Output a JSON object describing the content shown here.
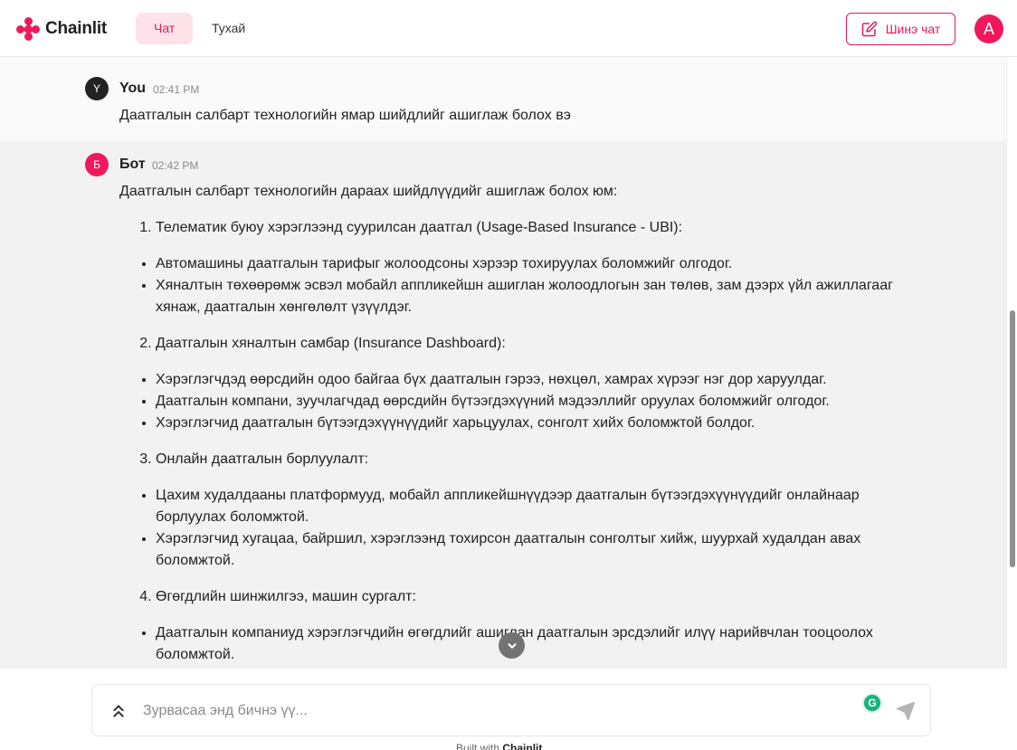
{
  "header": {
    "brand": "Chainlit",
    "tabs": [
      {
        "label": "Чат",
        "active": true
      },
      {
        "label": "Тухай",
        "active": false
      }
    ],
    "new_chat_label": "Шинэ чат",
    "user_initial": "A"
  },
  "colors": {
    "accent": "#e9185c",
    "accent_light": "#fde2ea",
    "bot_message_bg": "#f2f2f2"
  },
  "messages": [
    {
      "role": "user",
      "avatar_letter": "Y",
      "author": "You",
      "time": "02:41 PM",
      "text": "Даатгалын салбарт технологийн ямар шийдлийг ашиглаж болох вэ"
    },
    {
      "role": "bot",
      "avatar_letter": "Б",
      "author": "Бот",
      "time": "02:42 PM",
      "intro": "Даатгалын салбарт технологийн дараах шийдлүүдийг ашиглаж болох юм:",
      "sections": [
        {
          "title": "Телематик буюу хэрэглээнд суурилсан даатгал (Usage-Based Insurance - UBI):",
          "bullets": [
            "Автомашины даатгалын тарифыг жолоодсоны хэрээр тохируулах боломжийг олгодог.",
            "Хяналтын төхөөрөмж эсвэл мобайл аппликейшн ашиглан жолоодлогын зан төлөв, зам дээрх үйл ажиллагааг хянаж, даатгалын хөнгөлөлт үзүүлдэг."
          ]
        },
        {
          "title": "Даатгалын хяналтын самбар (Insurance Dashboard):",
          "bullets": [
            "Хэрэглэгчдэд өөрсдийн одоо байгаа бүх даатгалын гэрээ, нөхцөл, хамрах хүрээг нэг дор харуулдаг.",
            "Даатгалын компани, зуучлагчдад өөрсдийн бүтээгдэхүүний мэдээллийг оруулах боломжийг олгодог.",
            "Хэрэглэгчид даатгалын бүтээгдэхүүнүүдийг харьцуулах, сонголт хийх боломжтой болдог."
          ]
        },
        {
          "title": "Онлайн даатгалын борлуулалт:",
          "bullets": [
            "Цахим худалдааны платформууд, мобайл аппликейшнүүдээр даатгалын бүтээгдэхүүнүүдийг онлайнаар борлуулах боломжтой.",
            "Хэрэглэгчид хугацаа, байршил, хэрэглээнд тохирсон даатгалын сонголтыг хийж, шуурхай худалдан авах боломжтой."
          ]
        },
        {
          "title": "Өгөгдлийн шинжилгээ, машин сургалт:",
          "bullets": [
            "Даатгалын компаниуд хэрэглэгчдийн өгөгдлийг ашиглан даатгалын эрсдэлийг илүү нарийвчлан тооцоолох боломжтой."
          ]
        }
      ]
    }
  ],
  "composer": {
    "placeholder": "Зурвасаа энд бичнэ үү..."
  },
  "footer": {
    "built_with_label": "Built with",
    "brand": "Chainlit"
  },
  "icons": {
    "composer_toggle": "chevrons-up-icon",
    "send": "send-icon",
    "new_chat": "edit-icon",
    "scroll_down": "chevron-down-icon",
    "grammarly": "grammarly-icon"
  }
}
